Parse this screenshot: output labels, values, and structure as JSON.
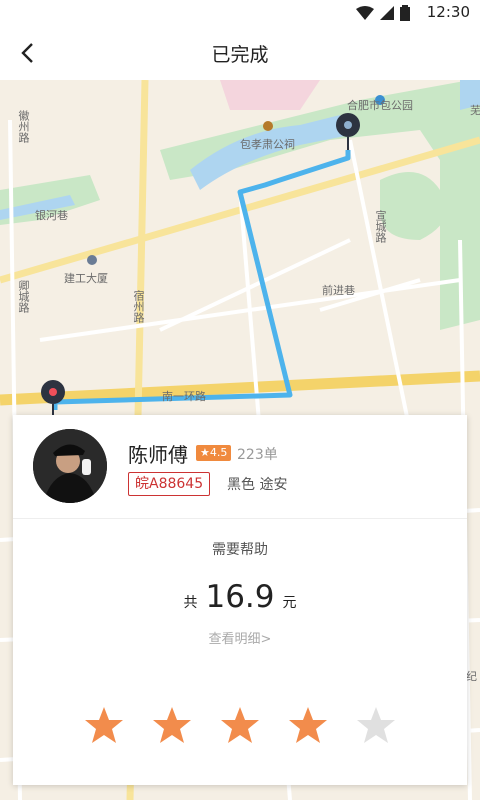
{
  "status_bar": {
    "time": "12:30"
  },
  "header": {
    "title": "已完成"
  },
  "map": {
    "labels": {
      "park": "合肥市包公园",
      "temple": "包孝肃公祠",
      "lane1": "银河巷",
      "building": "建工大厦",
      "lane2": "前进巷",
      "road_xuancheng": "宣城路",
      "road_ring": "南一环路",
      "road_suzhou": "宿州路",
      "road_north": "卿城路",
      "road_wuhu": "芜",
      "road_jiguang": "徽州路",
      "road_jishi": "纪"
    },
    "route_color": "#4db3ec"
  },
  "driver": {
    "name": "陈师傅",
    "rating": "★4.5",
    "orders": "223单",
    "plate": "皖A88645",
    "car": "黑色 途安"
  },
  "trip": {
    "help": "需要帮助",
    "total_prefix": "共",
    "amount": "16.9",
    "unit": "元",
    "details_link": "查看明细>"
  },
  "rating_stars": {
    "value": 4,
    "max": 5,
    "active_color": "#f28c4c",
    "inactive_color": "#e0e0e0"
  }
}
